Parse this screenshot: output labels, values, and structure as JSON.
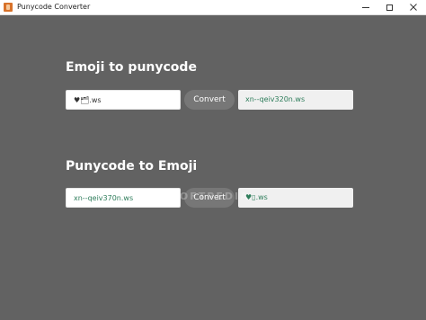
{
  "window": {
    "title": "Punycode Converter",
    "icon": "app-icon"
  },
  "sections": [
    {
      "title": "Emoji to punycode",
      "input_value": "♥🗂.ws",
      "button_label": "Convert",
      "output_value": "xn--qeiv320n.ws"
    },
    {
      "title": "Punycode to Emoji",
      "input_value": "xn--qeiv370n.ws",
      "button_label": "Convert",
      "output_value": "♥▯.ws"
    }
  ],
  "watermark": "SOFTPEDIA",
  "colors": {
    "background": "#626262",
    "button": "#777777",
    "value_text": "#2e7d5b"
  }
}
